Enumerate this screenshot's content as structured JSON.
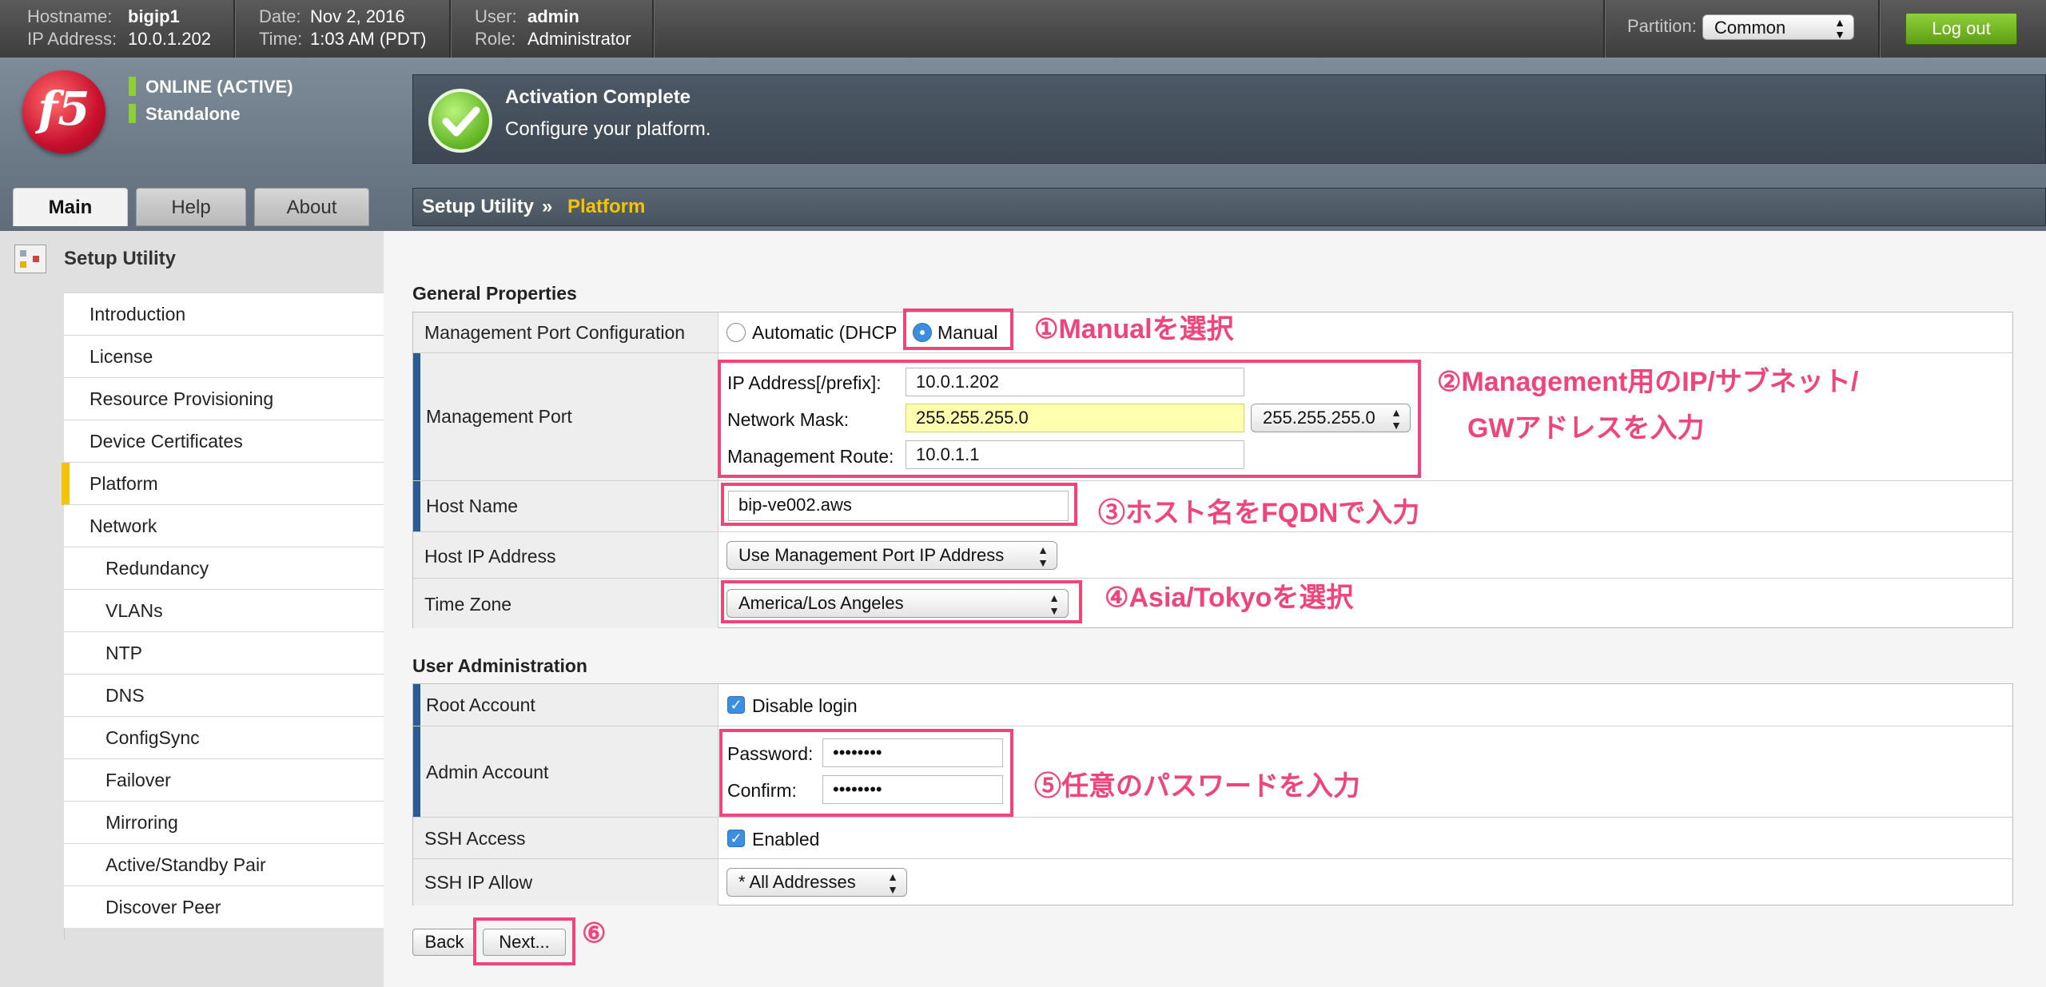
{
  "topbar": {
    "hostname_label": "Hostname:",
    "hostname": "bigip1",
    "ip_label": "IP Address:",
    "ip": "10.0.1.202",
    "date_label": "Date:",
    "date": "Nov 2, 2016",
    "time_label": "Time:",
    "time": "1:03 AM (PDT)",
    "user_label": "User:",
    "user": "admin",
    "role_label": "Role:",
    "role": "Administrator",
    "partition_label": "Partition:",
    "partition_value": "Common",
    "logout_label": "Log out"
  },
  "status": {
    "online": "ONLINE (ACTIVE)",
    "mode": "Standalone",
    "status_color": "#8ccf3a"
  },
  "logo_text": "f5",
  "banner": {
    "title": "Activation Complete",
    "subtitle": "Configure your platform."
  },
  "tabs": [
    {
      "label": "Main"
    },
    {
      "label": "Help"
    },
    {
      "label": "About"
    }
  ],
  "breadcrumb": {
    "root": "Setup Utility",
    "separator": "»",
    "current": "Platform"
  },
  "sidebar": {
    "title": "Setup Utility",
    "items": [
      {
        "label": "Introduction"
      },
      {
        "label": "License"
      },
      {
        "label": "Resource Provisioning"
      },
      {
        "label": "Device Certificates"
      },
      {
        "label": "Platform"
      },
      {
        "label": "Network"
      },
      {
        "label": "Redundancy"
      },
      {
        "label": "VLANs"
      },
      {
        "label": "NTP"
      },
      {
        "label": "DNS"
      },
      {
        "label": "ConfigSync"
      },
      {
        "label": "Failover"
      },
      {
        "label": "Mirroring"
      },
      {
        "label": "Active/Standby Pair"
      },
      {
        "label": "Discover Peer"
      }
    ]
  },
  "general": {
    "section_title": "General Properties",
    "mgmt_port_config": {
      "label": "Management Port Configuration",
      "option_auto": "Automatic (DHCP",
      "option_manual": "Manual",
      "selected": "Manual"
    },
    "mgmt_port": {
      "label": "Management Port",
      "ip_label": "IP Address[/prefix]:",
      "ip_value": "10.0.1.202",
      "mask_label": "Network Mask:",
      "mask_value": "255.255.255.0",
      "mask_select": "255.255.255.0",
      "route_label": "Management Route:",
      "route_value": "10.0.1.1"
    },
    "host_name": {
      "label": "Host Name",
      "value": "bip-ve002.aws"
    },
    "host_ip": {
      "label": "Host IP Address",
      "value": "Use Management Port IP Address"
    },
    "time_zone": {
      "label": "Time Zone",
      "value": "America/Los Angeles"
    }
  },
  "user_admin": {
    "section_title": "User Administration",
    "root_account": {
      "label": "Root Account",
      "checkbox_label": "Disable login",
      "checked": true
    },
    "admin_account": {
      "label": "Admin Account",
      "password_label": "Password:",
      "password_value": "••••••••",
      "confirm_label": "Confirm:",
      "confirm_value": "••••••••"
    },
    "ssh_access": {
      "label": "SSH Access",
      "checkbox_label": "Enabled",
      "checked": true
    },
    "ssh_ip_allow": {
      "label": "SSH IP Allow",
      "value": "* All Addresses"
    }
  },
  "buttons": {
    "back": "Back",
    "next": "Next..."
  },
  "annotations": {
    "a1": "①Manualを選択",
    "a2_line1": "②Management用のIP/サブネット/",
    "a2_line2": "GWアドレスを入力",
    "a3": "③ホスト名をFQDNで入力",
    "a4": "④Asia/Tokyoを選択",
    "a5": "⑤任意のパスワードを入力",
    "a6": "⑥",
    "color": "#f0457a"
  }
}
